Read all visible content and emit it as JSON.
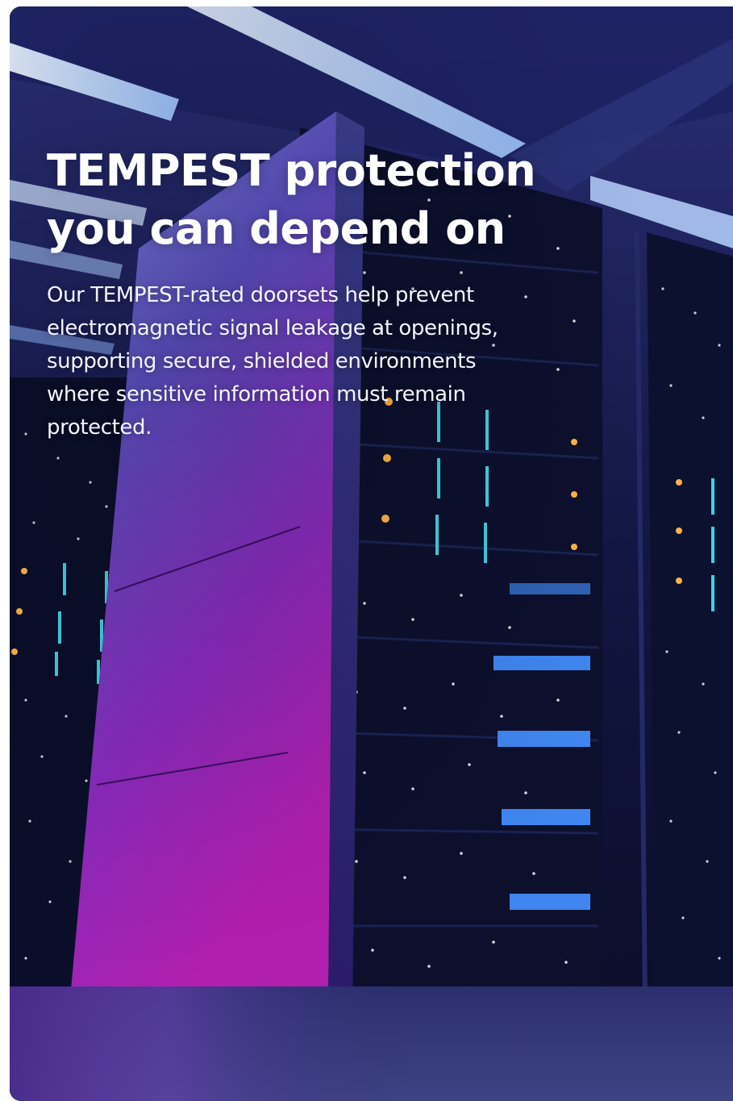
{
  "hero": {
    "headline_line1": "TEMPEST protection",
    "headline_line2": "you can depend on",
    "body": "Our TEMPEST-rated doorsets help prevent electromagnetic signal leakage at openings, supporting secure, shielded environments where sensitive information must remain protected.",
    "background_image": "server-racks-datacenter"
  },
  "colors": {
    "heading": "#ffffff",
    "body_text": "#f2f4ff",
    "accent_magenta": "#b21fb8",
    "accent_blue": "#3f86f0"
  }
}
